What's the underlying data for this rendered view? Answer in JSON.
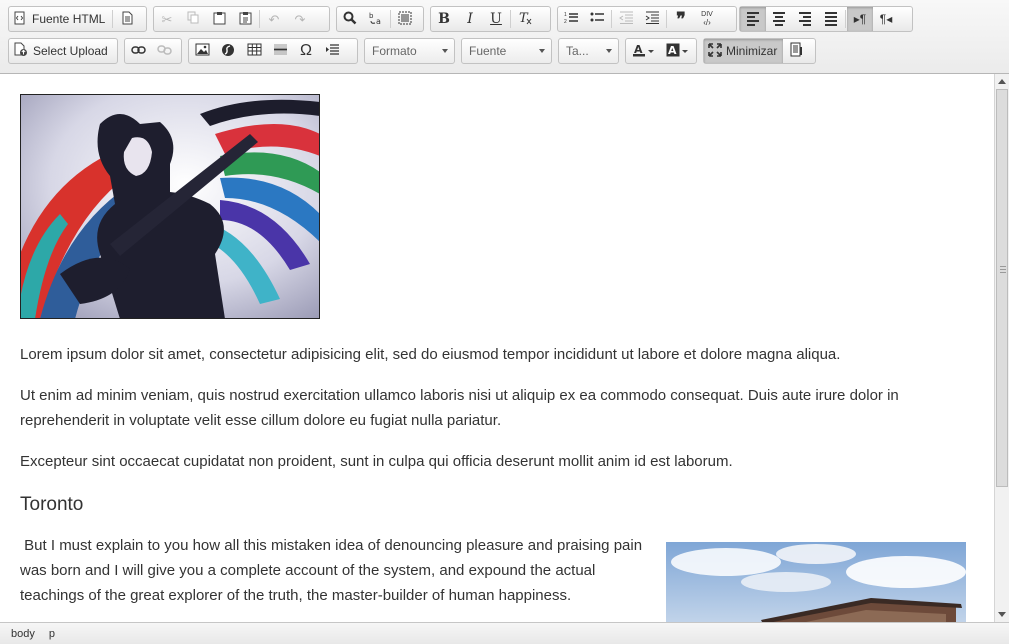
{
  "toolbar": {
    "source_label": "Fuente HTML",
    "upload_label": "Select Upload",
    "format_label": "Formato",
    "font_label": "Fuente",
    "size_label": "Ta...",
    "maximize_label": "Minimizar",
    "blockquote_glyph": "❞",
    "special_char_glyph": "Ω",
    "div_glyph": "DIV"
  },
  "content": {
    "paragraphs": [
      "Lorem ipsum dolor sit amet, consectetur adipisicing elit, sed do eiusmod tempor incididunt ut labore et dolore magna aliqua.",
      "Ut enim ad minim veniam, quis nostrud exercitation ullamco laboris nisi ut aliquip ex ea commodo consequat. Duis aute irure dolor in reprehenderit in voluptate velit esse cillum dolore eu fugiat nulla pariatur.",
      "Excepteur sint occaecat cupidatat non proident, sunt in culpa qui officia deserunt mollit anim id est laborum."
    ],
    "heading": "Toronto",
    "paragraph_toronto": " But I must explain to you how all this mistaken idea of denouncing pleasure and praising pain was born and I will give you a complete account of the system, and expound the actual teachings of the great explorer of the truth, the master-builder of human happiness."
  },
  "statusbar": {
    "path": [
      "body",
      "p"
    ]
  },
  "colors": {
    "toolbar_bg": "#ebebeb",
    "active_button": "#c9c9c9",
    "text": "#333333",
    "sky": "#8fb3d9"
  }
}
